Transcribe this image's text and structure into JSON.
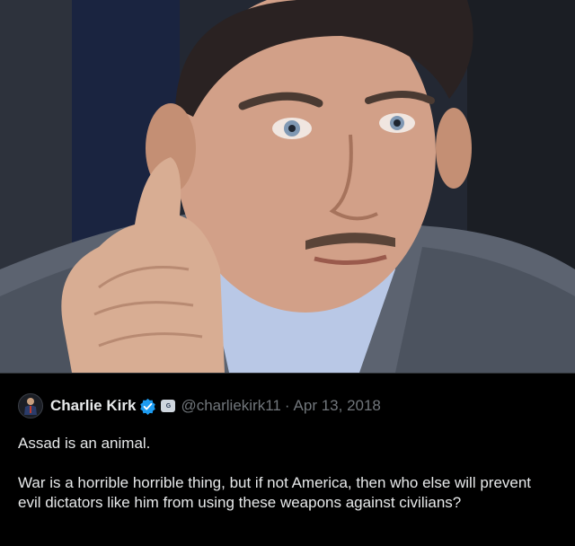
{
  "photo": {
    "subject": "portrait-photo"
  },
  "tweet": {
    "author_name": "Charlie Kirk",
    "handle": "@charliekirk11",
    "separator": "·",
    "date": "Apr 13, 2018",
    "paragraph_1": "Assad is an animal.",
    "paragraph_2": "War is a horrible horrible thing, but if not America, then who else will prevent evil dictators like him from using these weapons against civilians?",
    "affiliation_badge_text": "G"
  },
  "colors": {
    "background": "#000000",
    "text": "#e7e9ea",
    "muted": "#71767b",
    "verified": "#1d9bf0"
  },
  "icons": {
    "verified": "verified-badge-icon",
    "affiliation": "affiliation-badge-icon"
  }
}
